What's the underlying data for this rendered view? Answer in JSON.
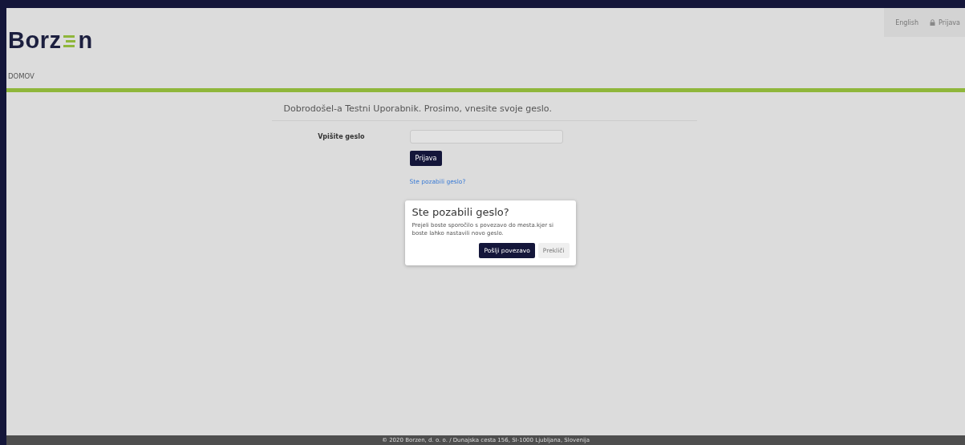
{
  "header": {
    "logo": {
      "before": "Borz",
      "after": "n"
    },
    "top_links": [
      {
        "kind": "text",
        "label": "English"
      },
      {
        "kind": "lock",
        "label": "Prijava"
      }
    ],
    "nav": [
      {
        "label": "DOMOV"
      }
    ]
  },
  "login": {
    "heading": "Dobrodošel-a Testni Uporabnik. Prosimo, vnesite svoje geslo.",
    "field_label": "Vpišite geslo",
    "submit": "Prijava",
    "forgot_link": "Ste pozabili geslo?"
  },
  "dialog": {
    "title": "Ste pozabili geslo?",
    "message": "Prejeli boste sporočilo s povezavo do mesta.kjer si boste lahko nastavili novo geslo.",
    "buttons": [
      {
        "kind": "primary",
        "label": "Pošlji povezavo"
      },
      {
        "kind": "secondary",
        "label": "Prekliči"
      }
    ]
  },
  "footer": {
    "text": "© 2020 Borzen, d. o. o. / Dunajska cesta 156, SI-1000 Ljubljana, Slovenija"
  }
}
